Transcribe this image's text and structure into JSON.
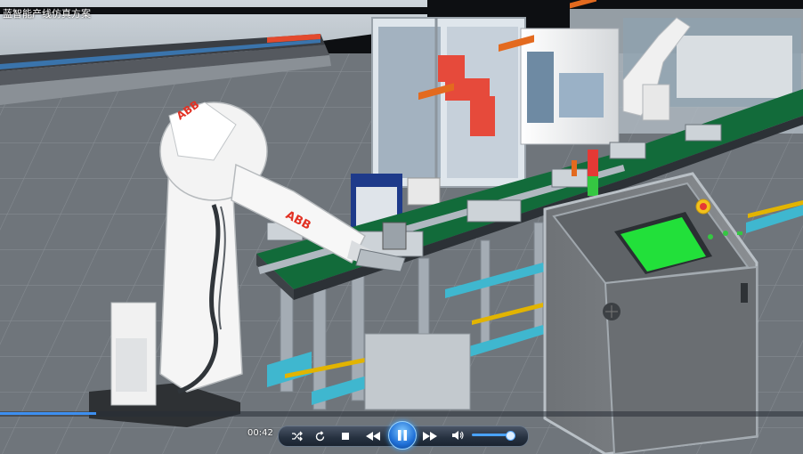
{
  "window": {
    "title": "蓝智能产线仿真方案"
  },
  "robot": {
    "brand": "ABB"
  },
  "player": {
    "time": "00:42",
    "progress": 0.12,
    "volume": 0.85,
    "state": "playing",
    "icons": {
      "shuffle": "shuffle-icon",
      "repeat": "repeat-icon",
      "stop": "stop-icon",
      "rewind": "rewind-icon",
      "play_pause": "pause-icon",
      "fast_forward": "fast-forward-icon",
      "volume": "volume-icon"
    }
  },
  "colors": {
    "accent": "#3d8ff0",
    "hmi_screen": "#22e03a",
    "robot_body": "#f2f2f2",
    "robot_red": "#e64a3b",
    "conveyor_green": "#126b3a",
    "beacon_red": "#e53935",
    "beacon_green": "#35c742",
    "floor": "#6f757b"
  }
}
